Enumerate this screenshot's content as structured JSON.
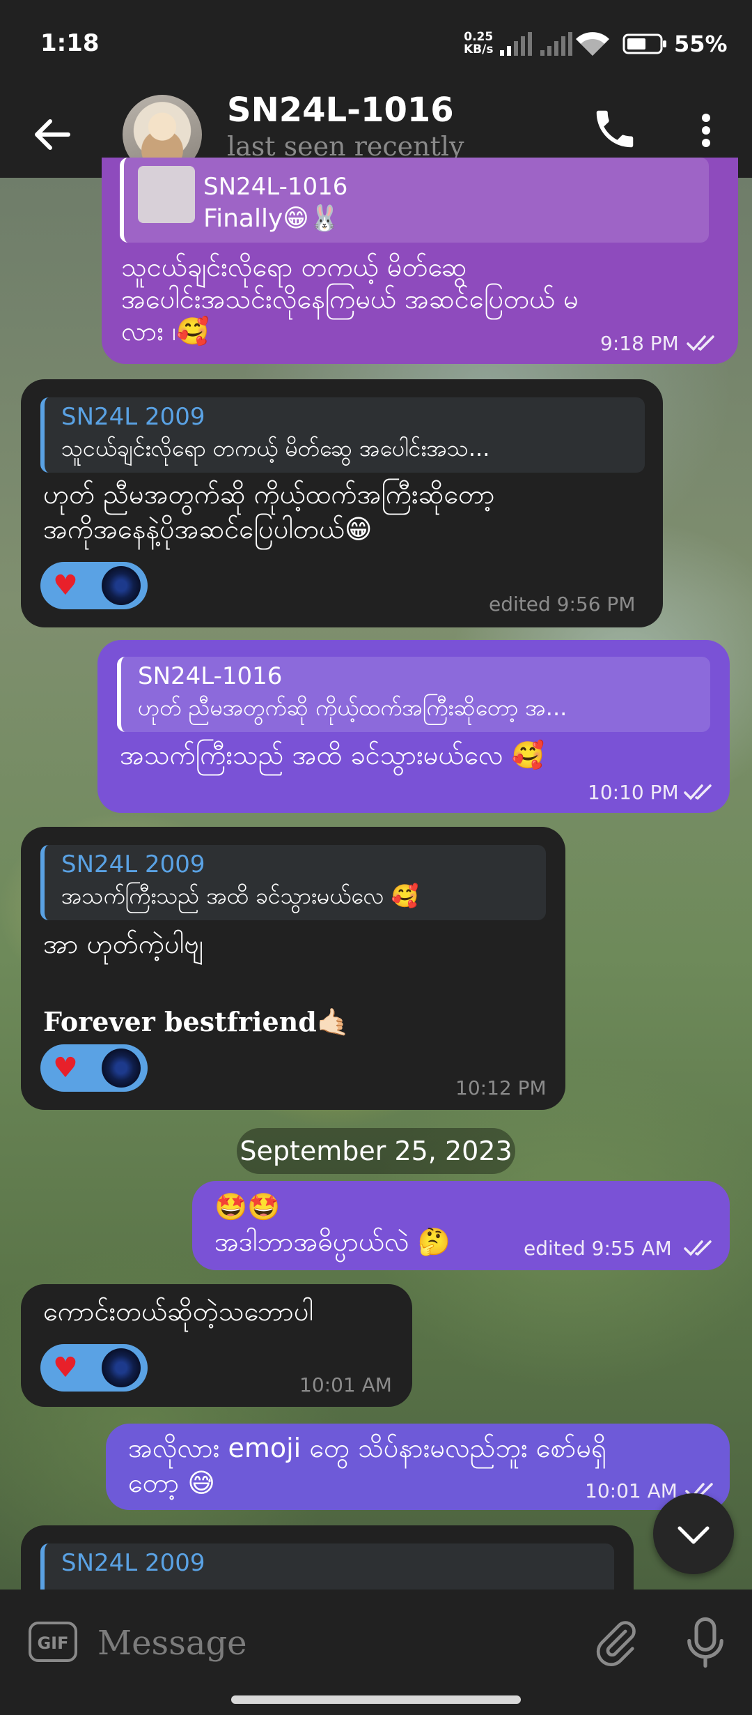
{
  "status_bar": {
    "time": "1:18",
    "net_speed_value": "0.25",
    "net_speed_unit": "KB/s",
    "battery_percent": "55%",
    "icons": [
      "signal-icon",
      "signal-icon",
      "wifi-icon",
      "battery-icon"
    ]
  },
  "header": {
    "title": "SN24L-1016",
    "subtitle": "last seen recently",
    "icons": [
      "back-arrow-icon",
      "phone-icon",
      "more-vert-icon"
    ]
  },
  "messages": [
    {
      "direction": "out",
      "reply_name": "SN24L-1016",
      "reply_text": "Finally😁🐰",
      "text_lines": [
        "သူငယ်ချင်းလိုရော တကယ့် မိတ်ဆွေ",
        "အပေါင်းအသင်းလိုနေကြမယ် အဆင်ပြေတယ် မ",
        "လား ၊🥰"
      ],
      "time": "9:18 PM"
    },
    {
      "direction": "in",
      "reply_name": "SN24L 2009",
      "reply_text": "သူငယ်ချင်းလိုရော တကယ့် မိတ်ဆွေ အပေါင်းအသ...",
      "text_lines": [
        "ဟုတ် ညီမအတွက်ဆို ကိုယ့်ထက်အကြီးဆိုတော့",
        "အကိုအနေနဲ့ပိုအဆင်ပြေပါတယ်😁"
      ],
      "reaction": "♥",
      "time": "edited 9:56 PM"
    },
    {
      "direction": "out",
      "reply_name": "SN24L-1016",
      "reply_text": "ဟုတ် ညီမအတွက်ဆို ကိုယ့်ထက်အကြီးဆိုတော့ အ...",
      "text_lines": [
        "အသက်ကြီးသည် အထိ ခင်သွားမယ်လေ 🥰"
      ],
      "time": "10:10 PM"
    },
    {
      "direction": "in",
      "reply_name": "SN24L 2009",
      "reply_text": "အသက်ကြီးသည် အထိ ခင်သွားမယ်လေ 🥰",
      "text_lines": [
        "အာ ဟုတ်ကဲ့ပါဗျ",
        "",
        "Forever bestfriend🤙🏻"
      ],
      "reaction": "♥",
      "time": "10:12 PM"
    },
    {
      "direction": "out",
      "text_lines": [
        "🤩🤩",
        "အဒါဘာအဓိပ္ပာယ်လဲ 🤔"
      ],
      "time": "edited 9:55 AM"
    },
    {
      "direction": "in",
      "text_lines": [
        "ကောင်းတယ်ဆိုတဲ့သဘောပါ"
      ],
      "reaction": "♥",
      "time": "10:01 AM"
    },
    {
      "direction": "out",
      "text_lines": [
        "အလိုလား emoji တွေ သိပ်နားမလည်ဘူး စော်မရှိ",
        "တော့ 😅"
      ],
      "time": "10:01 AM"
    },
    {
      "direction": "in",
      "reply_name": "SN24L 2009"
    }
  ],
  "date_separator": "September 25, 2023",
  "input": {
    "placeholder": "Message",
    "icons": [
      "gif-icon",
      "paperclip-icon",
      "microphone-icon",
      "chevron-down-icon"
    ]
  },
  "colors": {
    "header_bg": "#212121",
    "incoming_bubble": "#212121",
    "outgoing_bubble": "#8e4bbd",
    "reply_accent": "#5aa2e4",
    "reaction_bg": "#5aa2e4"
  }
}
